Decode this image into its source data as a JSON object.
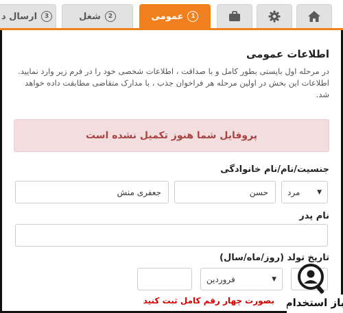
{
  "tabs": [
    {
      "num": "1",
      "label": "عمومی",
      "active": true
    },
    {
      "num": "2",
      "label": "شغل",
      "active": false
    },
    {
      "num": "3",
      "label": "ارسال د",
      "active": false
    }
  ],
  "icons": [
    "home-icon",
    "gear-icon",
    "briefcase-icon"
  ],
  "colors": {
    "accent": "#f07f1d",
    "alert_bg": "#f2dede",
    "alert_text": "#a94442",
    "error_text": "#d40000"
  },
  "section": {
    "title": "اطلاعات عمومی",
    "intro": "در مرحله اول بایستی بطور کامل و با صداقت ، اطلاعات شخصی خود را در فرم زیر وارد نمایید. اطلاعات این بخش در اولین مرحله هر فراخوان جذب ، با مدارک متقاضی مطابقت داده خواهد شد."
  },
  "alert": "پروفایل شما هنوز تکمیل نشده است",
  "form": {
    "name_label": "جنسیت/نام/نام خانوادگی",
    "gender_value": "مرد",
    "first_name_value": "حسن",
    "last_name_value": "جعفری منش",
    "father_label": "نام پدر",
    "father_value": "",
    "birth_label": "تاریخ تولد (روز/ماه/سال)",
    "month_value": "فروردین",
    "day_value": "",
    "year_value": "",
    "year_error": "بصورت چهار رقم کامل ثبت کنید"
  },
  "watermark": "باز استخدام"
}
